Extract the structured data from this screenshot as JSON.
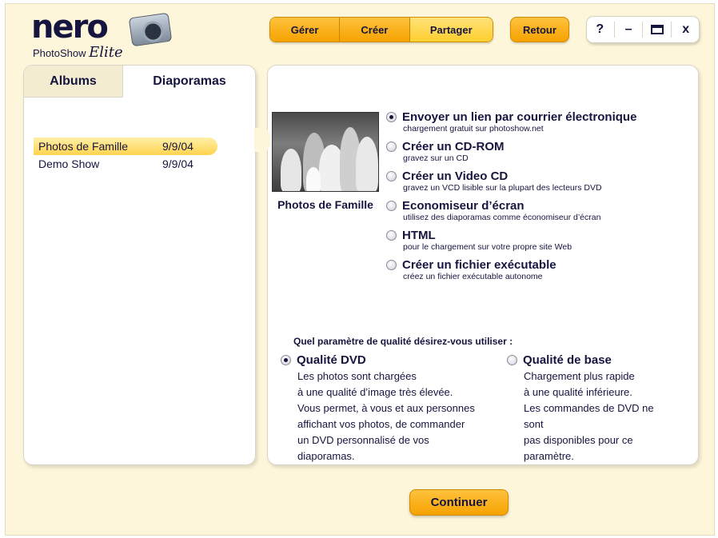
{
  "logo": {
    "nero": "nero",
    "photoshow": "PhotoShow",
    "elite": "Elite"
  },
  "topnav": {
    "gerer": "Gérer",
    "creer": "Créer",
    "partager": "Partager"
  },
  "retour": "Retour",
  "window_controls": {
    "help": "?",
    "minimize": "–",
    "close": "x"
  },
  "left_tabs": {
    "albums": "Albums",
    "diaporamas": "Diaporamas"
  },
  "shows": [
    {
      "name": "Photos de Famille",
      "date": "9/9/04",
      "selected": true
    },
    {
      "name": "Demo Show",
      "date": "9/9/04",
      "selected": false
    }
  ],
  "photo_caption": "Photos de Famille",
  "share_options": [
    {
      "title": "Envoyer un lien par courrier électronique",
      "desc": "chargement gratuit sur photoshow.net",
      "selected": true
    },
    {
      "title": "Créer un CD-ROM",
      "desc": "gravez sur un CD",
      "selected": false
    },
    {
      "title": "Créer un Video CD",
      "desc": "gravez un VCD lisible sur la plupart des lecteurs DVD",
      "selected": false
    },
    {
      "title": "Economiseur d’écran",
      "desc": "utilisez des diaporamas comme économiseur d’écran",
      "selected": false
    },
    {
      "title": "HTML",
      "desc": "pour le chargement sur votre propre site Web",
      "selected": false
    },
    {
      "title": "Créer un fichier exécutable",
      "desc": "créez un fichier exécutable autonome",
      "selected": false
    }
  ],
  "quality": {
    "question": "Quel paramètre de qualité désirez-vous utiliser :",
    "dvd": {
      "title": "Qualité DVD",
      "lines": [
        "Les photos sont chargées",
        "à une qualité d’image très élevée.",
        "Vous permet, à vous et aux personnes",
        "affichant vos photos, de commander",
        "un DVD personnalisé de vos",
        "diaporamas."
      ],
      "selected": true
    },
    "base": {
      "title": "Qualité de base",
      "lines": [
        "Chargement plus rapide",
        "à une qualité inférieure.",
        "Les commandes de DVD ne",
        "sont",
        "pas disponibles pour ce",
        "paramètre."
      ],
      "selected": false
    }
  },
  "continue_label": "Continuer"
}
